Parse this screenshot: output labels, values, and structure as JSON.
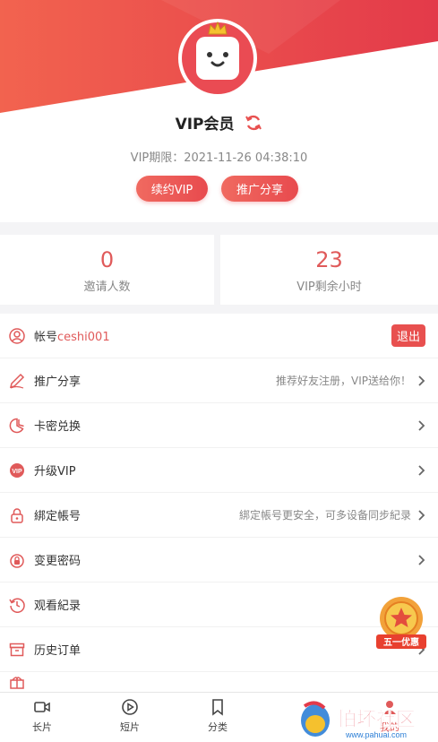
{
  "header": {
    "title": "VIP会员",
    "expire_text": "VIP期限：2021-11-26 04:38:10",
    "renew_label": "续约VIP",
    "promote_label": "推广分享",
    "accent_color": "#e84a4e"
  },
  "stats": {
    "invites": {
      "value": "0",
      "label": "邀请人数"
    },
    "vip_hours": {
      "value": "23",
      "label": "VIP剩余小时"
    }
  },
  "menu": {
    "account": {
      "prefix": "帐号",
      "name": "ceshi001",
      "logout_label": "退出",
      "icon": "user-icon"
    },
    "promote": {
      "label": "推广分享",
      "hint": "推荐好友注册，VIP送给你！",
      "icon": "pen-icon"
    },
    "card_redeem": {
      "label": "卡密兑换",
      "icon": "pie-icon"
    },
    "upgrade_vip": {
      "label": "升级VIP",
      "icon": "vip-icon"
    },
    "bind_account": {
      "label": "綁定帳号",
      "hint": "綁定帳号更安全，可多设备同步紀录",
      "icon": "lock-icon"
    },
    "change_password": {
      "label": "变更密码",
      "icon": "lock-refresh-icon"
    },
    "watch_history": {
      "label": "观看紀录",
      "icon": "history-icon"
    },
    "order_history": {
      "label": "历史订单",
      "icon": "box-icon"
    }
  },
  "promo_badge": {
    "text": "五一优惠"
  },
  "tabbar": {
    "tabs": [
      {
        "label": "长片",
        "icon": "video-icon"
      },
      {
        "label": "短片",
        "icon": "play-icon"
      },
      {
        "label": "分类",
        "icon": "bookmark-icon"
      },
      {
        "label": "我的",
        "icon": "user-icon"
      }
    ]
  },
  "watermark": {
    "title": "怕坏社区",
    "url": "www.pahuai.com"
  }
}
